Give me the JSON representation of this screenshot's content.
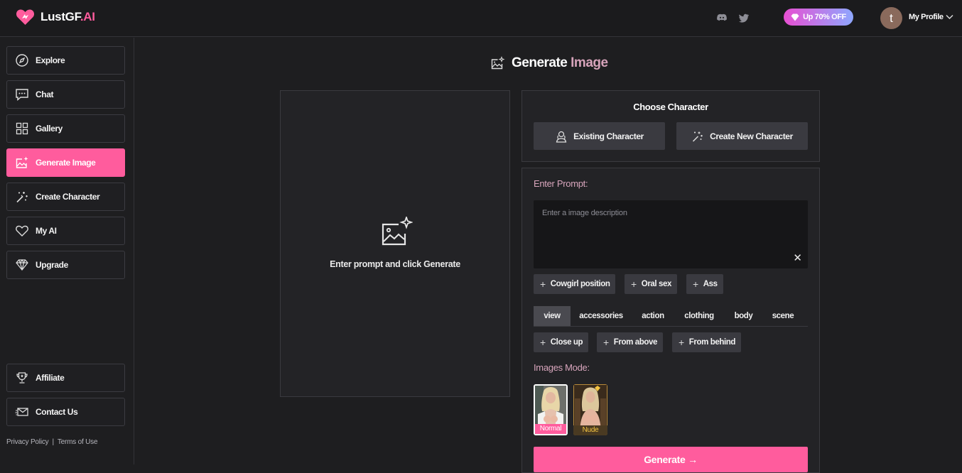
{
  "app": {
    "logo_main": "LustGF",
    "logo_suffix": ".AI"
  },
  "topbar": {
    "promo_label": "Up 70% OFF",
    "avatar_initial": "t",
    "profile_label": "My Profile"
  },
  "sidebar": {
    "items": [
      {
        "label": "Explore",
        "icon": "compass-icon"
      },
      {
        "label": "Chat",
        "icon": "chat-icon"
      },
      {
        "label": "Gallery",
        "icon": "grid-icon"
      },
      {
        "label": "Generate Image",
        "icon": "image-sparkle-icon",
        "active": true
      },
      {
        "label": "Create Character",
        "icon": "magic-wand-icon"
      },
      {
        "label": "My AI",
        "icon": "heart-icon"
      },
      {
        "label": "Upgrade",
        "icon": "diamond-icon"
      }
    ],
    "bottom_items": [
      {
        "label": "Affiliate",
        "icon": "trophy-icon"
      },
      {
        "label": "Contact Us",
        "icon": "envelope-icon"
      }
    ],
    "footer": {
      "privacy": "Privacy Policy",
      "separator": "|",
      "terms": "Terms of Use"
    }
  },
  "main": {
    "title_main": "Generate",
    "title_accent": "Image",
    "preview_text": "Enter prompt and click Generate",
    "choose_character": {
      "title": "Choose Character",
      "existing": "Existing Character",
      "create_new": "Create New Character"
    },
    "prompt": {
      "label": "Enter Prompt:",
      "placeholder": "Enter a image description",
      "clear": "✕",
      "suggestions": [
        "Cowgirl position",
        "Oral sex",
        "Ass"
      ],
      "tabs": [
        "view",
        "accessories",
        "action",
        "clothing",
        "body",
        "scene"
      ],
      "active_tab": "view",
      "tab_options": [
        "Close up",
        "From above",
        "From behind"
      ]
    },
    "images_mode": {
      "label": "Images Mode:",
      "modes": [
        {
          "label": "Normal",
          "selected": true,
          "color": "#ff5c9d"
        },
        {
          "label": "Nude",
          "selected": false,
          "color": "#f5c542"
        }
      ]
    },
    "generate_label": "Generate →"
  },
  "colors": {
    "accent": "#ff5c9d",
    "background": "#1e1e20",
    "panel": "#232326"
  }
}
